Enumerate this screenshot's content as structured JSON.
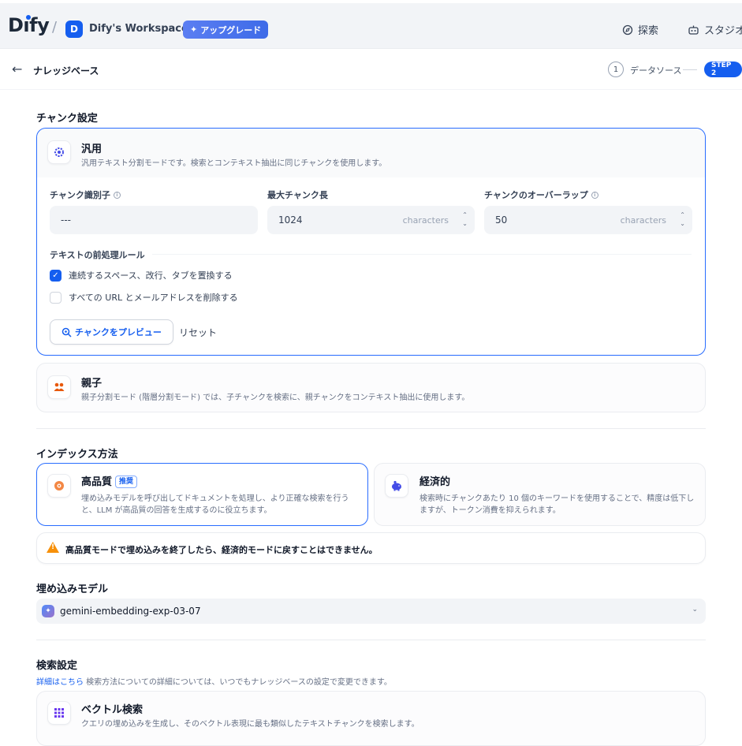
{
  "topbar": {
    "logo": "Dify",
    "workspace_initial": "D",
    "workspace_name": "Dify's Workspace",
    "upgrade_label": "アップグレード",
    "nav_explore": "探索",
    "nav_studio": "スタジオ"
  },
  "subbar": {
    "title": "ナレッジベース",
    "step1_num": "1",
    "step1_label": "データソース",
    "step2_label": "STEP 2"
  },
  "chunk": {
    "section_title": "チャンク設定",
    "general": {
      "title": "汎用",
      "desc": "汎用テキスト分割モードです。検索とコンテキスト抽出に同じチャンクを使用します。",
      "separator_label": "チャンク識別子",
      "separator_value": "---",
      "max_len_label": "最大チャンク長",
      "max_len_value": "1024",
      "max_len_unit": "characters",
      "overlap_label": "チャンクのオーバーラップ",
      "overlap_value": "50",
      "overlap_unit": "characters",
      "rules_label": "テキストの前処理ルール",
      "rule1": "連続するスペース、改行、タブを置換する",
      "rule1_checked": true,
      "rule2": "すべての URL とメールアドレスを削除する",
      "rule2_checked": false,
      "preview_button": "チャンクをプレビュー",
      "reset_button": "リセット"
    },
    "parent_child": {
      "title": "親子",
      "desc": "親子分割モード (階層分割モード) では、子チャンクを検索に、親チャンクをコンテキスト抽出に使用します。"
    }
  },
  "index": {
    "section_title": "インデックス方法",
    "high_quality": {
      "title": "高品質",
      "badge": "推奨",
      "desc": "埋め込みモデルを呼び出してドキュメントを処理し、より正確な検索を行うと、LLM が高品質の回答を生成するのに役立ちます。"
    },
    "economy": {
      "title": "経済的",
      "desc": "検索時にチャンクあたり 10 個のキーワードを使用することで、精度は低下しますが、トークン消費を抑えられます。"
    },
    "warning": "高品質モードで埋め込みを終了したら、経済的モードに戻すことはできません。"
  },
  "embedding": {
    "section_title": "埋め込みモデル",
    "model_name": "gemini-embedding-exp-03-07"
  },
  "retrieval": {
    "section_title": "検索設定",
    "learn_more": "詳細はこちら",
    "desc": " 検索方法についての詳細については、いつでもナレッジベースの設定で変更できます。",
    "vector": {
      "title": "ベクトル検索",
      "desc": "クエリの埋め込みを生成し、そのベクトル表現に最も類似したテキストチャンクを検索します。"
    }
  },
  "colors": {
    "accent": "#155eef",
    "active_border": "#296dff",
    "warning": "#f79009"
  }
}
